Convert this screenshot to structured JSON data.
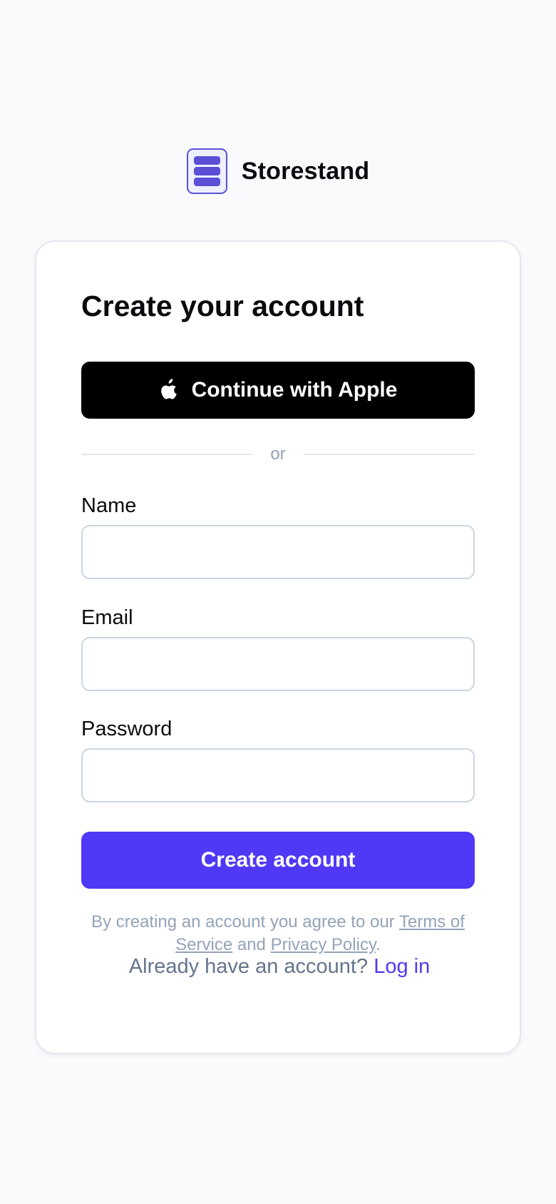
{
  "brand": {
    "name": "Storestand",
    "logo_icon": "server-stack-icon",
    "accent_color": "#5b4fd6"
  },
  "card": {
    "title": "Create your account",
    "apple_button": {
      "label": "Continue with Apple",
      "icon": "apple-icon"
    },
    "divider_text": "or",
    "fields": {
      "name": {
        "label": "Name",
        "value": "",
        "placeholder": ""
      },
      "email": {
        "label": "Email",
        "value": "",
        "placeholder": ""
      },
      "password": {
        "label": "Password",
        "value": "",
        "placeholder": ""
      }
    },
    "submit_label": "Create account",
    "submit_color": "#4f39f6",
    "legal": {
      "prefix": "By creating an account you agree to our ",
      "terms_link": "Terms of Service",
      "middle": " and ",
      "privacy_link": "Privacy Policy",
      "suffix": "."
    },
    "login_prompt": {
      "text": "Already have an account? ",
      "link": "Log in"
    }
  }
}
